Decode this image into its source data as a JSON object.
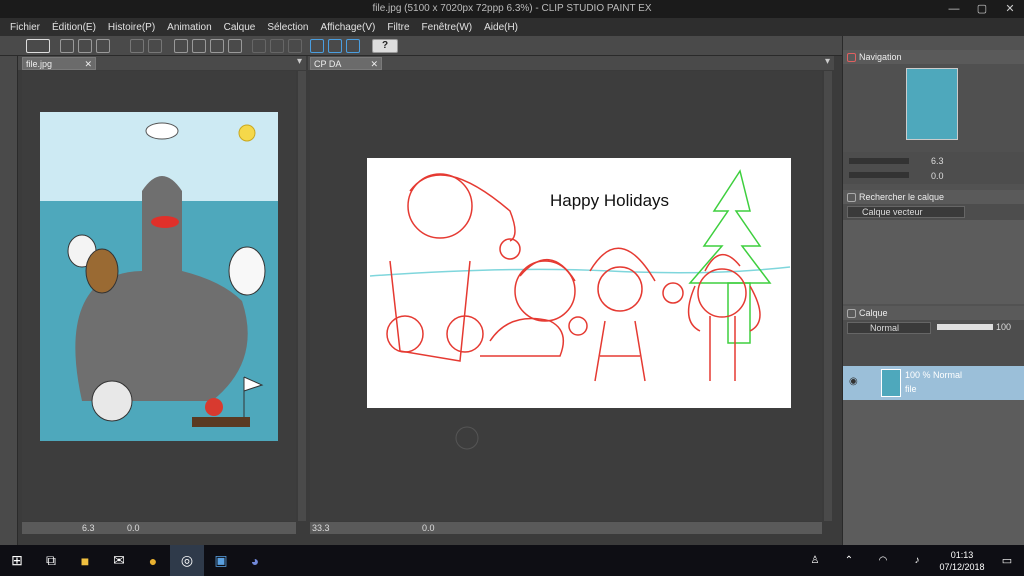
{
  "window": {
    "title": "file.jpg (5100 x 7020px 72ppp 6.3%) - CLIP STUDIO PAINT EX"
  },
  "menu": [
    "Fichier",
    "Édition(E)",
    "Histoire(P)",
    "Animation",
    "Calque",
    "Sélection",
    "Affichage(V)",
    "Filtre",
    "Fenêtre(W)",
    "Aide(H)"
  ],
  "tabs": {
    "left": "file.jpg",
    "right": "CP DA"
  },
  "canvas_right": {
    "text": "Happy Holidays"
  },
  "status": {
    "left_zoom": "6.3",
    "left_angle": "0.0",
    "right_zoom": "33.3",
    "right_angle": "0.0"
  },
  "navigator": {
    "title": "Navigation",
    "zoom": "6.3",
    "angle": "0.0"
  },
  "layer_search": {
    "title": "Rechercher le calque",
    "layer_type": "Calque vecteur"
  },
  "layers_panel": {
    "title": "Calque",
    "blend_mode": "Normal",
    "opacity": "100",
    "layers": [
      {
        "line1": "100 % Normal",
        "line2": "file"
      }
    ]
  },
  "taskbar": {
    "time": "01:13",
    "date": "07/12/2018"
  },
  "colors": {
    "accent_blue": "#1f5a8c",
    "sky": "#cdeaf3",
    "sea": "#4ea8bc",
    "sketch_red": "#e53a32",
    "sketch_green": "#3ecf3e"
  }
}
